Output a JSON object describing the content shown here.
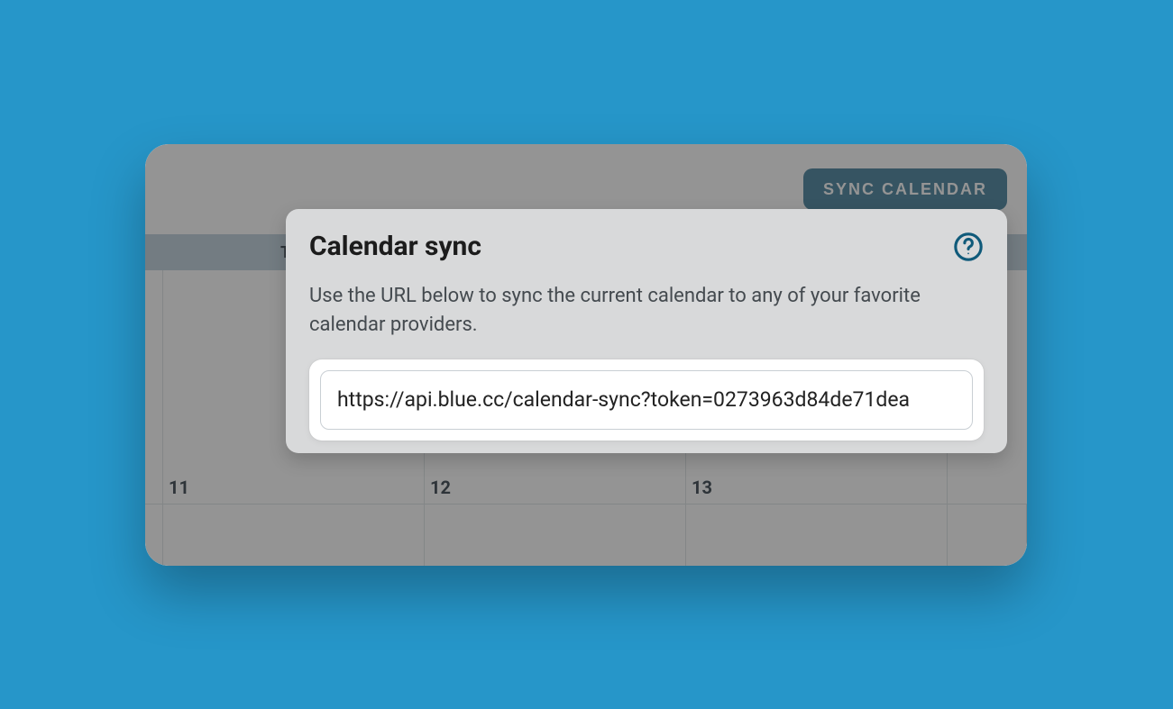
{
  "header": {
    "sync_button_label": "SYNC CALENDAR"
  },
  "calendar": {
    "visible_weekday_fragment": "T",
    "days_row1": [
      "11",
      "12",
      "13"
    ]
  },
  "popover": {
    "title": "Calendar sync",
    "description": "Use the URL below to sync the current calendar to any of your favorite calendar providers.",
    "url_value": "https://api.blue.cc/calendar-sync?token=0273963d84de71dea"
  }
}
